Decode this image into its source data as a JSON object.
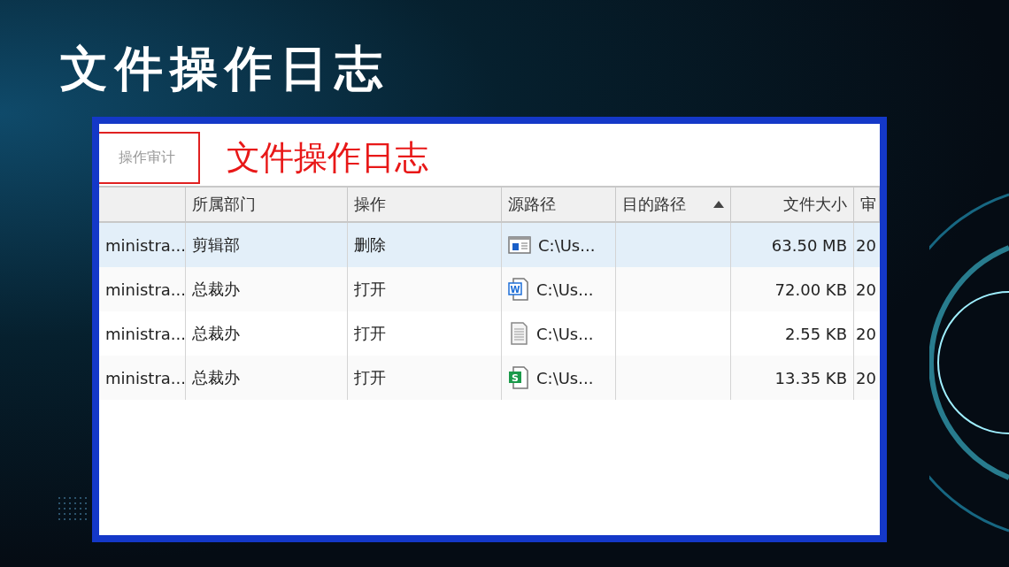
{
  "slide_title": "文件操作日志",
  "toolbar": {
    "tab_label": "操作审计",
    "annotation": "文件操作日志"
  },
  "table": {
    "columns": [
      {},
      {
        "label": "所属部门"
      },
      {
        "label": "操作"
      },
      {
        "label": "源路径"
      },
      {
        "label": "目的路径",
        "sorted": true
      },
      {
        "label": "文件大小"
      },
      {
        "label": "审"
      }
    ],
    "rows": [
      {
        "selected": true,
        "user": "ministra...",
        "department": "剪辑部",
        "action": "删除",
        "file_icon": {
          "kind": "media"
        },
        "source": "C:\\Us...",
        "size": "63.50 MB",
        "time": "20"
      },
      {
        "selected": false,
        "user": "ministra...",
        "department": "总裁办",
        "action": "打开",
        "file_icon": {
          "kind": "word",
          "letter": "W"
        },
        "source": "C:\\Us...",
        "size": "72.00 KB",
        "time": "20"
      },
      {
        "selected": false,
        "user": "ministra...",
        "department": "总裁办",
        "action": "打开",
        "file_icon": {
          "kind": "text"
        },
        "source": "C:\\Us...",
        "size": "2.55 KB",
        "time": "20"
      },
      {
        "selected": false,
        "user": "ministra...",
        "department": "总裁办",
        "action": "打开",
        "file_icon": {
          "kind": "sheet",
          "letter": "S"
        },
        "source": "C:\\Us...",
        "size": "13.35 KB",
        "time": "20"
      }
    ]
  }
}
